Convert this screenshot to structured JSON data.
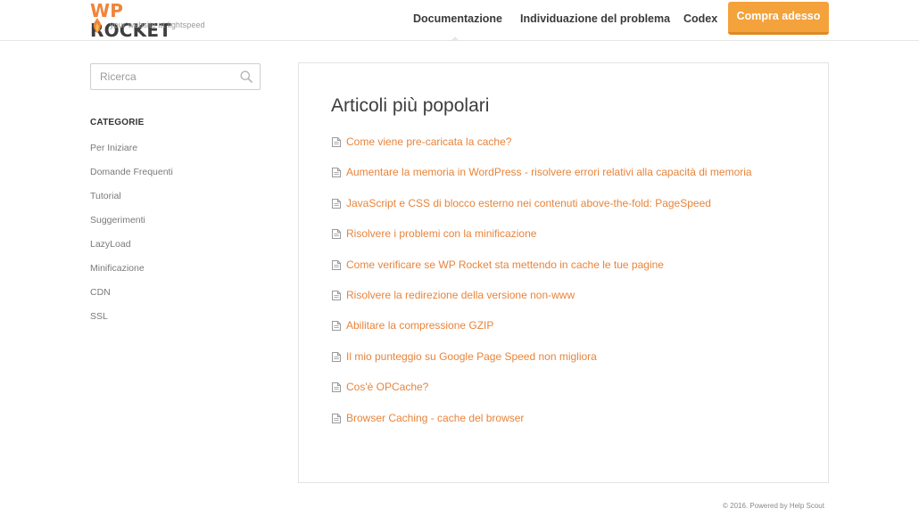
{
  "brand": {
    "logo_prefix": "WP",
    "logo_name": "ROCKET",
    "tagline": "your website at lightspeed",
    "accent_color": "#f0843a"
  },
  "nav": {
    "items": [
      {
        "label": "Documentazione"
      },
      {
        "label": "Individuazione del problema"
      },
      {
        "label": "Codex"
      }
    ],
    "cta_label": "Compra adesso",
    "cta_color": "#f4a23b"
  },
  "search": {
    "placeholder": "Ricerca",
    "value": "",
    "icon": "search-icon"
  },
  "sidebar": {
    "title": "CATEGORIE",
    "items": [
      {
        "label": "Per Iniziare"
      },
      {
        "label": "Domande Frequenti"
      },
      {
        "label": "Tutorial"
      },
      {
        "label": "Suggerimenti"
      },
      {
        "label": "LazyLoad"
      },
      {
        "label": "Minificazione"
      },
      {
        "label": "CDN"
      },
      {
        "label": "SSL"
      }
    ]
  },
  "main": {
    "title": "Articoli più popolari",
    "article_icon": "document-icon",
    "link_color": "#e8843b",
    "articles": [
      {
        "label": "Come viene pre-caricata la cache?"
      },
      {
        "label": "Aumentare la memoria in WordPress - risolvere errori relativi alla capacità di memoria"
      },
      {
        "label": "JavaScript e CSS di blocco esterno nei contenuti above-the-fold: PageSpeed"
      },
      {
        "label": "Risolvere i problemi con la minificazione"
      },
      {
        "label": "Come verificare se WP Rocket sta mettendo in cache le tue pagine"
      },
      {
        "label": "Risolvere la redirezione della versione non-www"
      },
      {
        "label": "Abilitare la compressione GZIP"
      },
      {
        "label": "Il mio punteggio su Google Page Speed non migliora"
      },
      {
        "label": "Cos'è OPCache?"
      },
      {
        "label": "Browser Caching - cache del browser"
      }
    ]
  },
  "footer": {
    "text": "© 2016. Powered by Help Scout"
  }
}
